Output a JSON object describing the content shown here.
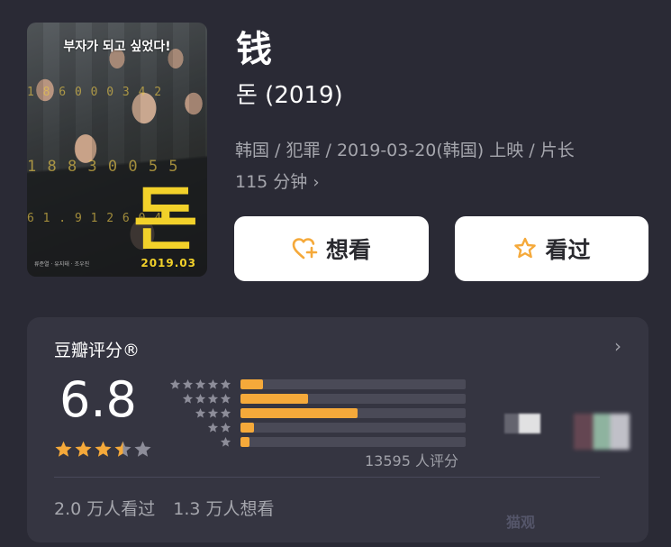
{
  "poster": {
    "tagline": "부자가 되고 싶었다!",
    "title_kr": "돈",
    "release_badge": "2019.03",
    "ticker_lines": [
      "1 8 6 0 0 0 3 4 2",
      "1 8 8 3 0 0 5 5",
      "6 1 . 9 1 2 6 0 4"
    ],
    "credits": "류준열 · 유지태 · 조우진"
  },
  "movie": {
    "title": "钱",
    "original_title": "돈 (2019)",
    "meta_line1": "韩国 / 犯罪 / 2019-03-20(韩国) 上映 / 片长",
    "meta_line2": "115 分钟",
    "meta_chevron": "›"
  },
  "actions": {
    "want_label": "想看",
    "seen_label": "看过",
    "want_icon": "heart-plus-icon",
    "seen_icon": "star-outline-icon",
    "icon_color": "#f5a93a"
  },
  "rating": {
    "header": "豆瓣评分®",
    "header_chevron": "›",
    "score": "6.8",
    "stars_value": 3.5,
    "distribution": [
      {
        "stars": 5,
        "fraction": 0.1
      },
      {
        "stars": 4,
        "fraction": 0.3
      },
      {
        "stars": 3,
        "fraction": 0.52
      },
      {
        "stars": 2,
        "fraction": 0.06
      },
      {
        "stars": 1,
        "fraction": 0.04
      }
    ],
    "count_label": "13595 人评分",
    "seen_stat": "2.0 万人看过",
    "want_stat": "1.3 万人想看",
    "watermark": "猫观"
  },
  "colors": {
    "background": "#2a2a35",
    "card": "#353541",
    "accent": "#f5a93a",
    "star_empty": "#8d8d99"
  }
}
